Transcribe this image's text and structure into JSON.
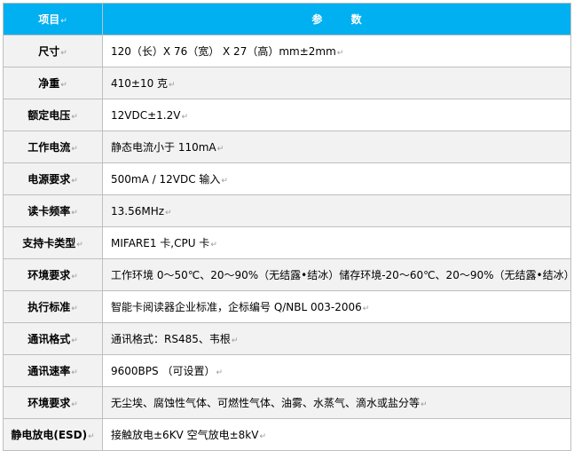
{
  "header": {
    "col1": "项目",
    "col2": "参 数"
  },
  "paragraph_mark": "↵",
  "rows": [
    {
      "name": "尺寸",
      "value": "120（长）X 76（宽）  X 27（高）mm±2mm"
    },
    {
      "name": "净重",
      "value": "410±10 克"
    },
    {
      "name": "额定电压",
      "value": "12VDC±1.2V"
    },
    {
      "name": "工作电流",
      "value": "静态电流小于 110mA"
    },
    {
      "name": "电源要求",
      "value": "500mA / 12VDC 输入"
    },
    {
      "name": "读卡频率",
      "value": "13.56MHz"
    },
    {
      "name": "支持卡类型",
      "value": "MIFARE1 卡,CPU 卡"
    },
    {
      "name": "环境要求",
      "value": "工作环境 0～50℃、20～90%（无结露•结冰）储存环境-20～60℃、20～90%（无结露•结冰）"
    },
    {
      "name": "执行标准",
      "value": "智能卡阅读器企业标准，企标编号 Q/NBL 003-2006"
    },
    {
      "name": "通讯格式",
      "value": "通讯格式：RS485、韦根"
    },
    {
      "name": "通讯速率",
      "value": "9600BPS  （可设置）"
    },
    {
      "name": "环境要求",
      "value": "无尘埃、腐蚀性气体、可燃性气体、油雾、水蒸气、滴水或盐分等"
    },
    {
      "name": "静电放电(ESD)",
      "value": "接触放电±6KV  空气放电±8kV"
    }
  ]
}
